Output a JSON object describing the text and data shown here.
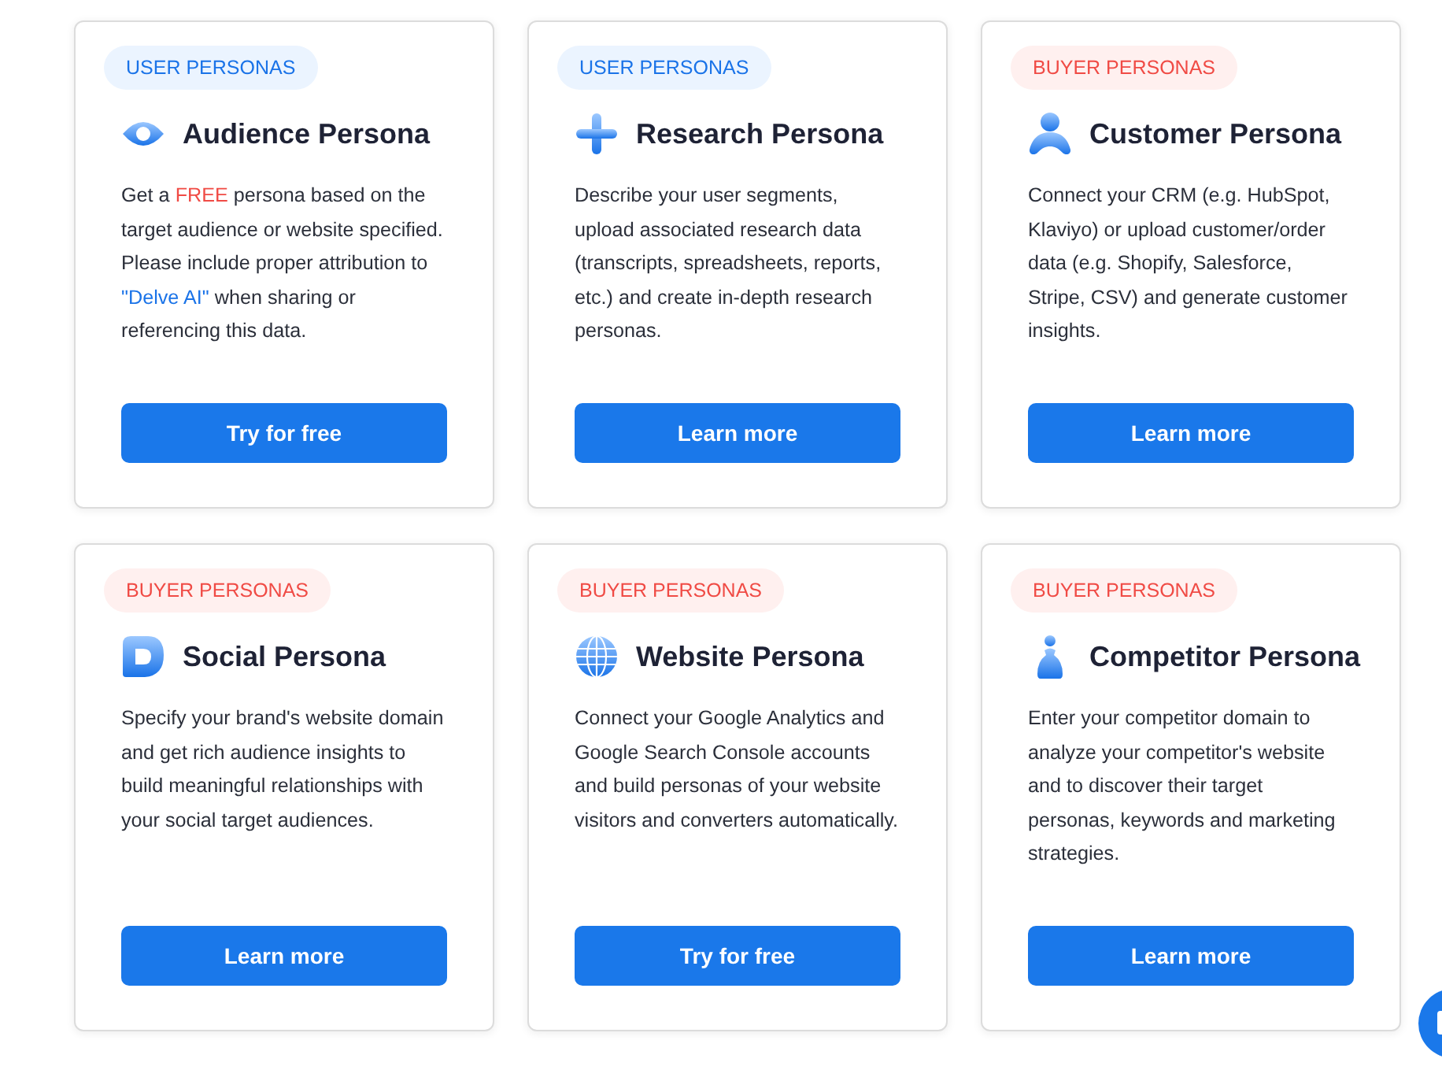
{
  "cards": [
    {
      "badge": {
        "label": "USER PERSONAS",
        "kind": "user"
      },
      "title": "Audience Persona",
      "description": [
        {
          "kind": "text",
          "text": "Get a "
        },
        {
          "kind": "highlight",
          "text": "FREE"
        },
        {
          "kind": "text",
          "text": " persona based on the target audience or website specified. Please include proper attribution to "
        },
        {
          "kind": "link",
          "text": "\"Delve AI\""
        },
        {
          "kind": "text",
          "text": " when sharing or referencing this data."
        }
      ],
      "button": "Try for free"
    },
    {
      "badge": {
        "label": "USER PERSONAS",
        "kind": "user"
      },
      "title": "Research Persona",
      "description": [
        {
          "kind": "text",
          "text": "Describe your user segments, upload associated research data (transcripts, spreadsheets, reports, etc.) and create in-depth research personas."
        }
      ],
      "button": "Learn more"
    },
    {
      "badge": {
        "label": "BUYER PERSONAS",
        "kind": "buyer"
      },
      "title": "Customer Persona",
      "description": [
        {
          "kind": "text",
          "text": "Connect your CRM (e.g. HubSpot, Klaviyo) or upload customer/order data (e.g. Shopify, Salesforce, Stripe, CSV) and generate customer insights."
        }
      ],
      "button": "Learn more"
    },
    {
      "badge": {
        "label": "BUYER PERSONAS",
        "kind": "buyer"
      },
      "title": "Social Persona",
      "description": [
        {
          "kind": "text",
          "text": "Specify your brand's website domain and get rich audience insights to build meaningful relationships with your social target audiences."
        }
      ],
      "button": "Learn more"
    },
    {
      "badge": {
        "label": "BUYER PERSONAS",
        "kind": "buyer"
      },
      "title": "Website Persona",
      "description": [
        {
          "kind": "text",
          "text": "Connect your Google Analytics and Google Search Console accounts and build personas of your website visitors and converters automatically."
        }
      ],
      "button": "Try for free"
    },
    {
      "badge": {
        "label": "BUYER PERSONAS",
        "kind": "buyer"
      },
      "title": "Competitor Persona",
      "description": [
        {
          "kind": "text",
          "text": "Enter your competitor domain to analyze your competitor's website and to discover their target personas, keywords and marketing strategies."
        }
      ],
      "button": "Learn more"
    }
  ]
}
